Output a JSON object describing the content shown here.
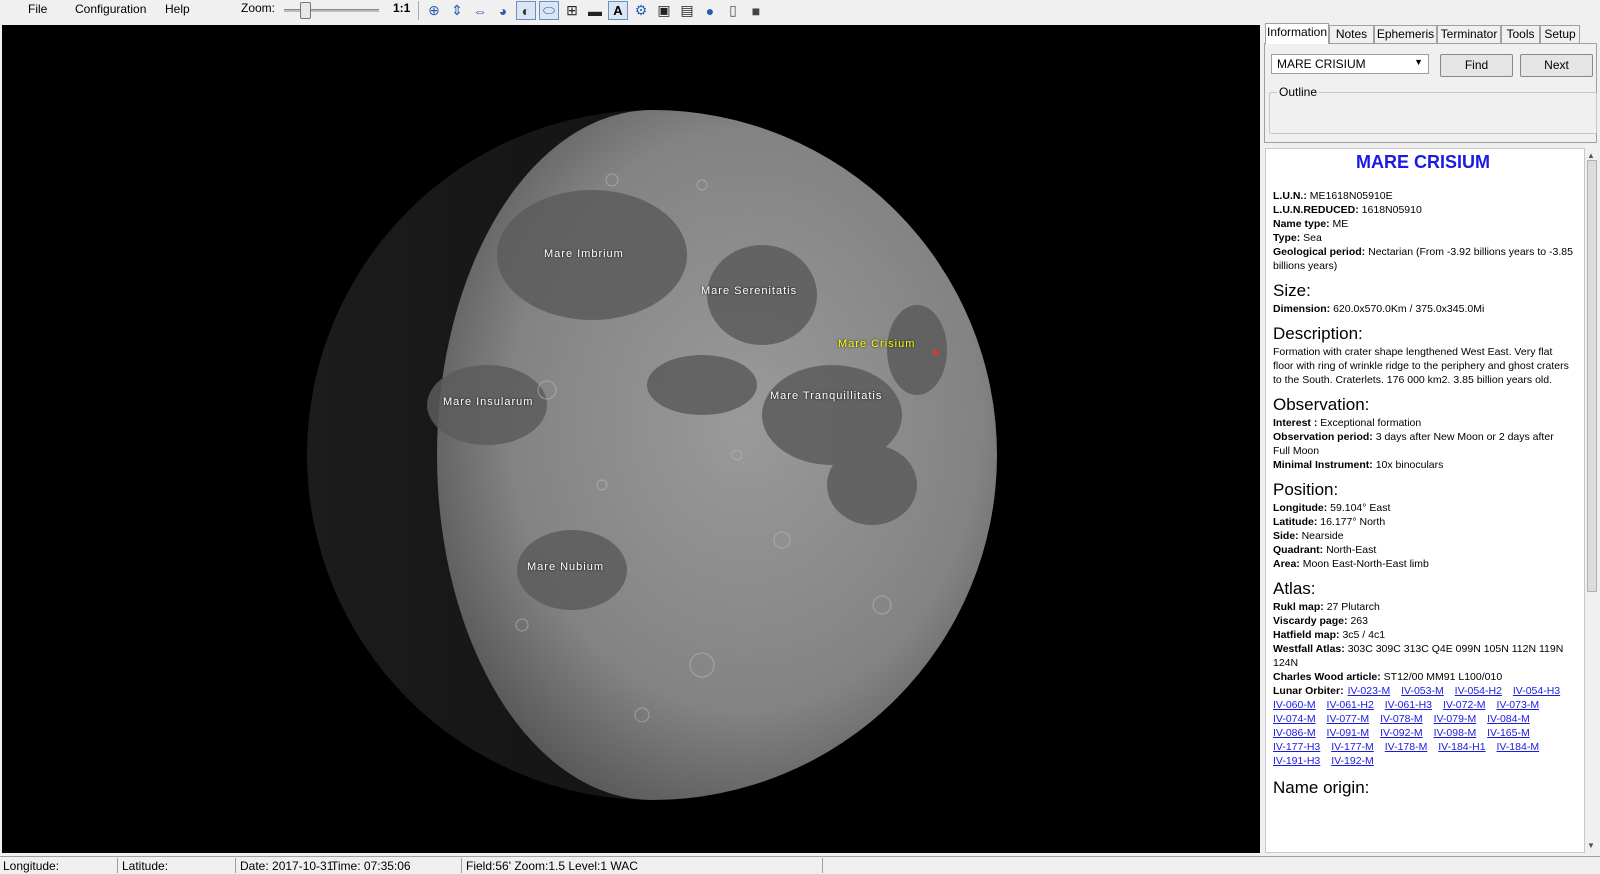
{
  "menu": [
    "File",
    "Configuration",
    "Help"
  ],
  "toolbar": {
    "zoom_label": "Zoom:",
    "zoom_ratio": "1:1",
    "zoom_level": 0.18,
    "icons": [
      "crosshair-icon",
      "flip-vertical-icon",
      "flip-horizontal-icon",
      "globe-color-icon",
      "moon-phase-icon",
      "ellipse-icon",
      "grid-icon",
      "ruler-icon",
      "text-icon",
      "gear-icon",
      "camera-icon",
      "calendar-icon",
      "world-icon",
      "page-icon",
      "screen-icon"
    ]
  },
  "moon_labels": [
    {
      "text": "Mare Imbrium",
      "selected": false
    },
    {
      "text": "Mare Serenitatis",
      "selected": false
    },
    {
      "text": "Mare Crisium",
      "selected": true
    },
    {
      "text": "Mare Insularum",
      "selected": false
    },
    {
      "text": "Mare Tranquillitatis",
      "selected": false
    },
    {
      "text": "Mare Nubium",
      "selected": false
    }
  ],
  "tabs": [
    "Information",
    "Notes",
    "Ephemeris",
    "Terminator",
    "Tools",
    "Setup"
  ],
  "active_tab": "Information",
  "search": {
    "selected": "MARE CRISIUM",
    "find_label": "Find",
    "next_label": "Next",
    "outline_label": "Outline"
  },
  "info": {
    "title": "MARE CRISIUM",
    "lun": "ME1618N05910E",
    "lun_reduced": "1618N05910",
    "name_type": "ME",
    "type": "Sea",
    "geological_period": "Nectarian (From -3.92 billions years to -3.85 billions years)",
    "size_heading": "Size:",
    "dimension": "620.0x570.0Km / 375.0x345.0Mi",
    "description_heading": "Description:",
    "description": "Formation with crater shape lengthened West East. Very  flat floor with ring of wrinkle ridge to the periphery and ghost craters to the South. Craterlets. 176 000 km2. 3.85 billion years old.",
    "observation_heading": "Observation:",
    "interest": "Exceptional formation",
    "observation_period": "3 days after New Moon or 2 days after Full Moon",
    "minimal_instrument": "10x binoculars",
    "position_heading": "Position:",
    "longitude": "59.104° East",
    "latitude": "16.177° North",
    "side": "Nearside",
    "quadrant": "North-East",
    "area": "Moon East-North-East limb",
    "atlas_heading": "Atlas:",
    "rukl_map": "27 Plutarch",
    "viscardy_page": " 263",
    "hatfield_map": "3c5 / 4c1",
    "westfall_atlas": "303C 309C 313C Q4E 099N 105N 112N 119N 124N",
    "charles_wood": "ST12/00 MM91 L100/010",
    "lunar_orbiter": [
      "IV-023-M",
      "IV-053-M",
      "IV-054-H2",
      "IV-054-H3",
      "IV-060-M",
      "IV-061-H2",
      "IV-061-H3",
      "IV-072-M",
      "IV-073-M",
      "IV-074-M",
      "IV-077-M",
      "IV-078-M",
      "IV-079-M",
      "IV-084-M",
      "IV-086-M",
      "IV-091-M",
      "IV-092-M",
      "IV-098-M",
      "IV-165-M",
      "IV-177-H3",
      "IV-177-M",
      "IV-178-M",
      "IV-184-H1",
      "IV-184-M",
      "IV-191-H3",
      "IV-192-M"
    ],
    "name_origin_heading": "Name origin:"
  },
  "labels": {
    "lun": "L.U.N.:",
    "lun_reduced": "L.U.N.REDUCED:",
    "name_type": "Name type:",
    "type": "Type:",
    "geological_period": "Geological period:",
    "dimension": "Dimension:",
    "interest": "Interest :",
    "observation_period": "Observation period:",
    "minimal_instrument": "Minimal Instrument:",
    "longitude": "Longitude:",
    "latitude": "Latitude:",
    "side": "Side:",
    "quadrant": "Quadrant:",
    "area": "Area:",
    "rukl_map": "Rukl map:",
    "viscardy_page": "Viscardy page:",
    "hatfield_map": "Hatfield map:",
    "westfall_atlas": "Westfall Atlas:",
    "charles_wood": "Charles Wood article:",
    "lunar_orbiter": "Lunar Orbiter:"
  },
  "status": {
    "longitude": "Longitude:",
    "latitude": "Latitude:",
    "date": "Date: 2017-10-31",
    "time": "Time: 07:35:06",
    "field": "Field:56' Zoom:1.5  Level:1 WAC"
  }
}
